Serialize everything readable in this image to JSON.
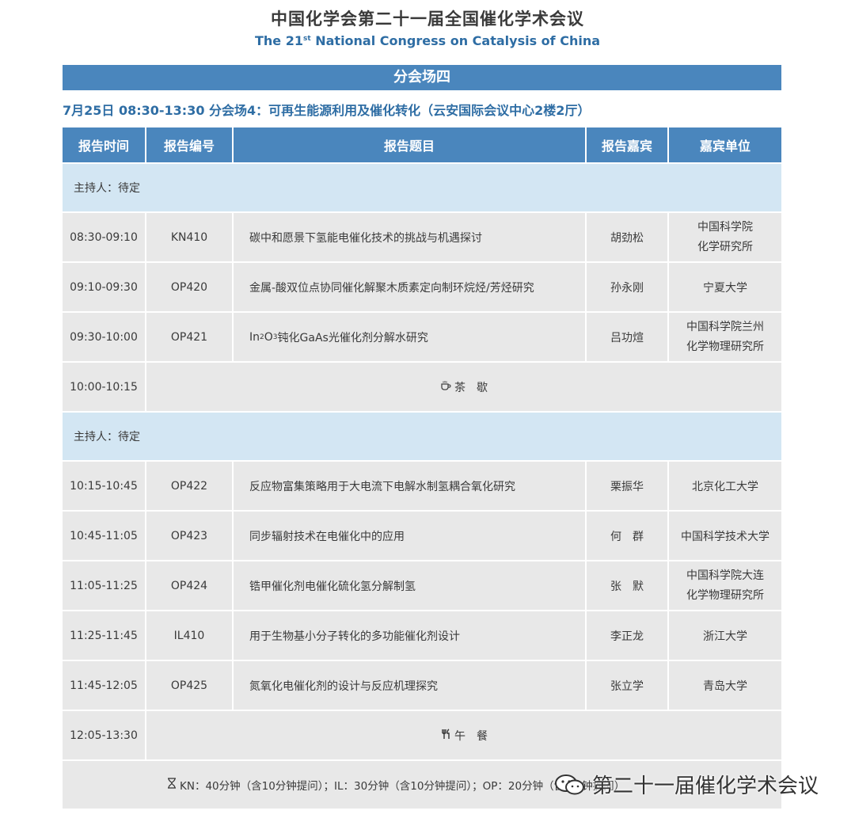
{
  "header": {
    "title_cn": "中国化学会第二十一届全国催化学术会议",
    "title_en_prefix": "The 21",
    "title_en_sup": "st",
    "title_en_suffix": " National Congress on Catalysis of China"
  },
  "banner": "分会场四",
  "session": "7月25日 08:30-13:30 分会场4：可再生能源利用及催化转化（云安国际会议中心2楼2厅）",
  "columns": [
    "报告时间",
    "报告编号",
    "报告题目",
    "报告嘉宾",
    "嘉宾单位"
  ],
  "host1": "主持人：待定",
  "host2": "主持人：待定",
  "rows": [
    {
      "time": "08:30-09:10",
      "code": "KN410",
      "title": "碳中和愿景下氢能电催化技术的挑战与机遇探讨",
      "speaker": "胡劲松",
      "org_l1": "中国科学院",
      "org_l2": "化学研究所"
    },
    {
      "time": "09:10-09:30",
      "code": "OP420",
      "title": "金属-酸双位点协同催化解聚木质素定向制环烷烃/芳烃研究",
      "speaker": "孙永刚",
      "org_l1": "宁夏大学",
      "org_l2": ""
    },
    {
      "time": "09:30-10:00",
      "code": "OP421",
      "title_a": "In",
      "title_s1": "2",
      "title_b": "O",
      "title_s2": "3",
      "title_c": "钝化GaAs光催化剂分解水研究",
      "speaker": "吕功煊",
      "org_l1": "中国科学院兰州",
      "org_l2": "化学物理研究所"
    },
    {
      "time": "10:15-10:45",
      "code": "OP422",
      "title": "反应物富集策略用于大电流下电解水制氢耦合氧化研究",
      "speaker": "栗振华",
      "org_l1": "北京化工大学",
      "org_l2": ""
    },
    {
      "time": "10:45-11:05",
      "code": "OP423",
      "title": "同步辐射技术在电催化中的应用",
      "speaker": "何　群",
      "org_l1": "中国科学技术大学",
      "org_l2": ""
    },
    {
      "time": "11:05-11:25",
      "code": "OP424",
      "title": "锆甲催化剂电催化硫化氢分解制氢",
      "speaker": "张　默",
      "org_l1": "中国科学院大连",
      "org_l2": "化学物理研究所"
    },
    {
      "time": "11:25-11:45",
      "code": "IL410",
      "title": "用于生物基小分子转化的多功能催化剂设计",
      "speaker": "李正龙",
      "org_l1": "浙江大学",
      "org_l2": ""
    },
    {
      "time": "11:45-12:05",
      "code": "OP425",
      "title": "氮氧化电催化剂的设计与反应机理探究",
      "speaker": "张立学",
      "org_l1": "青岛大学",
      "org_l2": ""
    }
  ],
  "break": {
    "time": "10:00-10:15",
    "label": "茶　歇",
    "icon": "coffee-icon"
  },
  "lunch": {
    "time": "12:05-13:30",
    "label": "午　餐",
    "icon": "fork-knife-icon"
  },
  "footer": "KN：40分钟（含10分钟提问）；IL：30分钟（含10分钟提问）；OP：20分钟（含5分钟提问）",
  "watermark": "第二十一届催化学术会议",
  "colors": {
    "accent": "#4a86bd",
    "host_bg": "#d3e6f3",
    "cell_bg": "#e8e8e8",
    "subtitle": "#2e6da4"
  }
}
